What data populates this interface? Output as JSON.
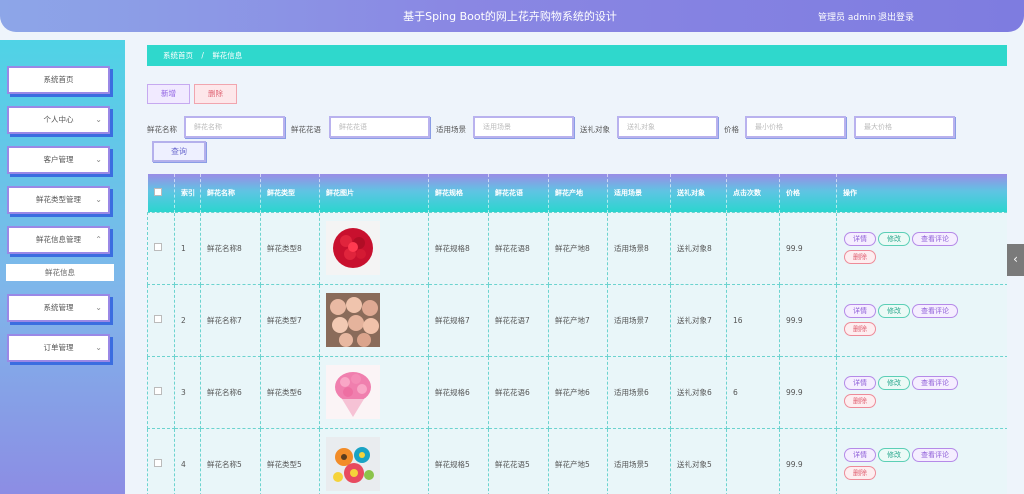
{
  "header": {
    "title": "基于Sping Boot的网上花卉购物系统的设计",
    "role": "管理员 admin",
    "logout": "退出登录"
  },
  "sidebar": {
    "items": [
      {
        "label": "系统首页",
        "has_chevron": false
      },
      {
        "label": "个人中心",
        "has_chevron": true
      },
      {
        "label": "客户管理",
        "has_chevron": true
      },
      {
        "label": "鲜花类型管理",
        "has_chevron": true
      },
      {
        "label": "鲜花信息管理",
        "has_chevron": true,
        "expanded": true
      },
      {
        "label": "系统管理",
        "has_chevron": true
      },
      {
        "label": "订单管理",
        "has_chevron": true
      }
    ],
    "submenu": {
      "label": "鲜花信息"
    }
  },
  "breadcrumb": {
    "home": "系统首页",
    "sep": "/",
    "current": "鲜花信息"
  },
  "toolbar": {
    "add": "新增",
    "delete": "删除"
  },
  "filters": {
    "name_label": "鲜花名称",
    "name_placeholder": "鲜花名称",
    "lang_label": "鲜花花语",
    "lang_placeholder": "鲜花花语",
    "scene_label": "适用场景",
    "scene_placeholder": "适用场景",
    "target_label": "送礼对象",
    "target_placeholder": "送礼对象",
    "price_label": "价格",
    "min_price_placeholder": "最小价格",
    "max_price_placeholder": "最大价格",
    "query": "查询"
  },
  "table": {
    "headers": [
      "索引",
      "鲜花名称",
      "鲜花类型",
      "鲜花图片",
      "鲜花规格",
      "鲜花花语",
      "鲜花产地",
      "适用场景",
      "送礼对象",
      "点击次数",
      "价格",
      "操作"
    ],
    "ops": {
      "detail": "详情",
      "edit": "修改",
      "review": "查看评论",
      "delete": "删除"
    },
    "rows": [
      {
        "index": "1",
        "name": "鲜花名称8",
        "type": "鲜花类型8",
        "spec": "鲜花规格8",
        "lang": "鲜花花语8",
        "origin": "鲜花产地8",
        "scene": "适用场景8",
        "target": "送礼对象8",
        "clicks": "",
        "price": "99.9",
        "image": "red-rose-bouquet"
      },
      {
        "index": "2",
        "name": "鲜花名称7",
        "type": "鲜花类型7",
        "spec": "鲜花规格7",
        "lang": "鲜花花语7",
        "origin": "鲜花产地7",
        "scene": "适用场景7",
        "target": "送礼对象7",
        "clicks": "16",
        "price": "99.9",
        "image": "peach-rose-bouquet"
      },
      {
        "index": "3",
        "name": "鲜花名称6",
        "type": "鲜花类型6",
        "spec": "鲜花规格6",
        "lang": "鲜花花语6",
        "origin": "鲜花产地6",
        "scene": "适用场景6",
        "target": "送礼对象6",
        "clicks": "6",
        "price": "99.9",
        "image": "pink-rose-bouquet"
      },
      {
        "index": "4",
        "name": "鲜花名称5",
        "type": "鲜花类型5",
        "spec": "鲜花规格5",
        "lang": "鲜花花语5",
        "origin": "鲜花产地5",
        "scene": "适用场景5",
        "target": "送礼对象5",
        "clicks": "",
        "price": "99.9",
        "image": "paper-flower-art"
      }
    ]
  }
}
